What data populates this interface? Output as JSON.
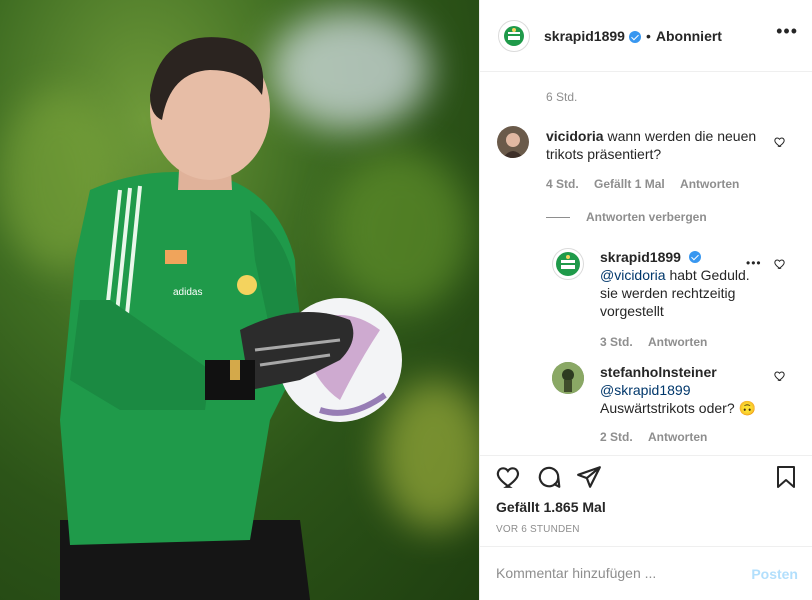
{
  "post": {
    "author": "skrapid1899",
    "follow_status": "Abonniert",
    "dot": "•",
    "more": "•••",
    "caption_time": "6 Std.",
    "likes": "Gefällt 1.865 Mal",
    "posted_ago": "VOR 6 STUNDEN"
  },
  "comments": [
    {
      "user": "vicidoria",
      "text": "wann werden die neuen trikots präsentiert?",
      "time": "4 Std.",
      "likes": "Gefällt 1 Mal",
      "reply": "Antworten",
      "hide_replies": "Antworten verbergen"
    }
  ],
  "replies": [
    {
      "user": "skrapid1899",
      "mention": "@vicidoria",
      "text": "habt Geduld. sie werden rechtzeitig vorgestellt",
      "time": "3 Std.",
      "reply": "Antworten",
      "more": "•••"
    },
    {
      "user": "stefanholnsteiner",
      "mention": "@skrapid1899",
      "text": "Auswärtstrikots oder? 🙃",
      "time": "2 Std.",
      "reply": "Antworten"
    }
  ],
  "composer": {
    "placeholder": "Kommentar hinzufügen ...",
    "submit": "Posten"
  },
  "icons": {
    "like": "heart-icon",
    "comment": "comment-icon",
    "share": "share-icon",
    "save": "bookmark-icon"
  }
}
